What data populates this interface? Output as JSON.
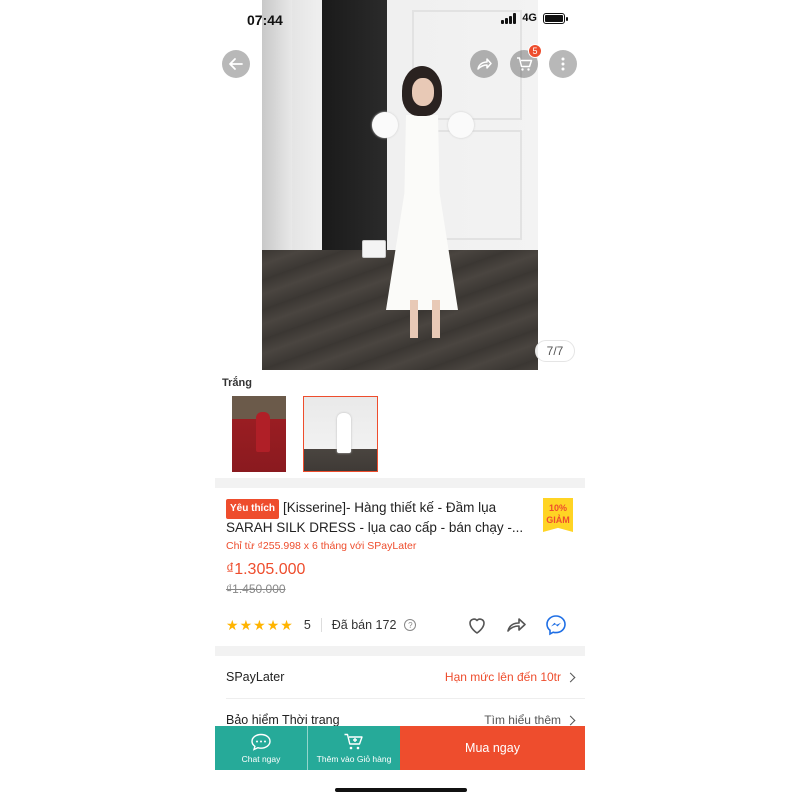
{
  "status_bar": {
    "time": "07:44",
    "network": "4G"
  },
  "header": {
    "cart_count": "5"
  },
  "gallery": {
    "counter": "7/7"
  },
  "variation": {
    "label": "Trắng"
  },
  "product": {
    "badge": "Yêu thích",
    "title": "[Kisserine]- Hàng thiết kế - Đầm lụa SARAH SILK DRESS - lụa cao cấp - bán chạy -...",
    "discount_line1": "10%",
    "discount_line2": "GIẢM",
    "spaylater_note": "Chỉ từ ₫255.998 x 6 tháng với SPayLater",
    "price": "₫1.305.000",
    "old_price": "₫1.450.000",
    "rating": "5",
    "sold": "Đã bán 172",
    "help_glyph": "?"
  },
  "rows": [
    {
      "label": "SPayLater",
      "value": "Hạn mức lên đến 10tr",
      "value_color": "#ee4d2d"
    },
    {
      "label": "Bảo hiểm Thời trang",
      "value": "Tìm hiểu thêm",
      "value_color": "#555555"
    }
  ],
  "bottom_bar": {
    "chat_label": "Chat ngay",
    "cart_label": "Thêm vào Giỏ hàng",
    "buy_label": "Mua ngay"
  },
  "colors": {
    "brand": "#ee4d2d",
    "teal": "#26aa99",
    "star": "#ffb400"
  },
  "icons": [
    "back-arrow-icon",
    "share-icon",
    "cart-icon",
    "more-icon",
    "heart-icon",
    "share-outline-icon",
    "messenger-icon",
    "chat-icon",
    "add-to-cart-icon",
    "star-icon",
    "help-icon",
    "chevron-right-icon"
  ]
}
